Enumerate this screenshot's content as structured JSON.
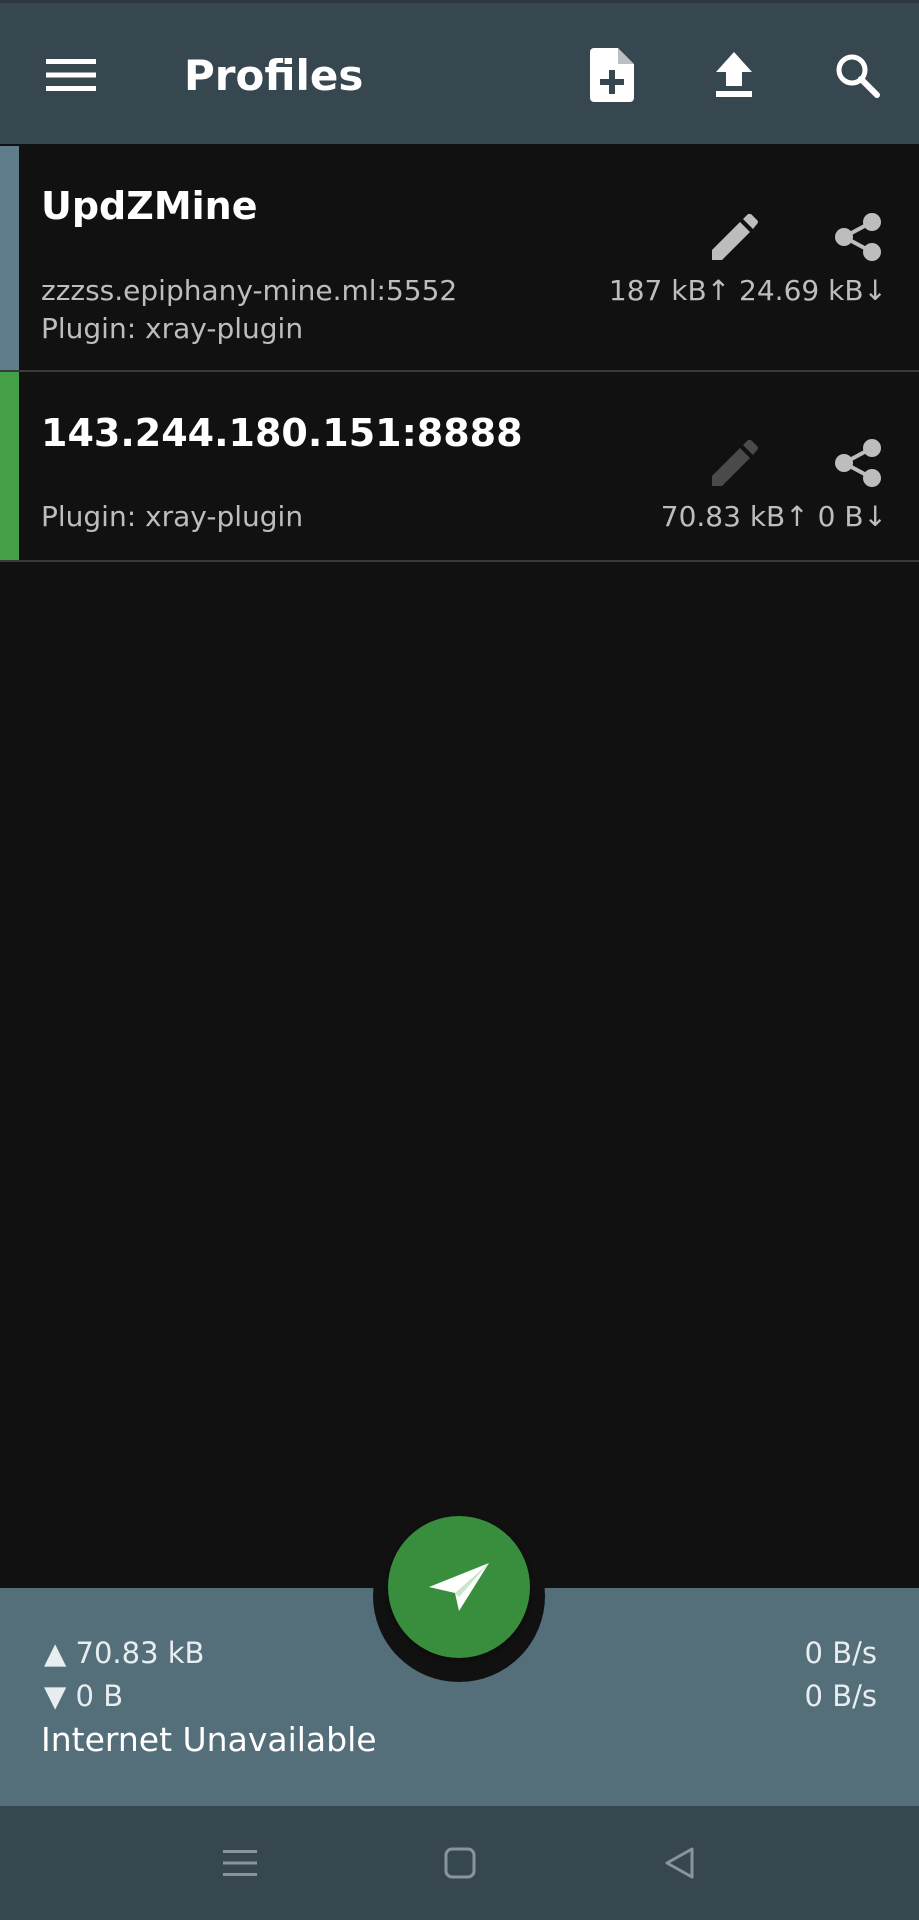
{
  "app_bar": {
    "title": "Profiles",
    "icons": [
      "menu-icon",
      "add-file-icon",
      "upload-icon",
      "search-icon"
    ]
  },
  "profiles": [
    {
      "name": "UpdZMine",
      "server": "zzzss.epiphany-mine.ml:5552",
      "plugin": "Plugin: xray-plugin",
      "traffic": "187 kB↑ 24.69 kB↓",
      "selected": false
    },
    {
      "name": "143.244.180.151:8888",
      "server": "",
      "plugin": "Plugin: xray-plugin",
      "traffic": "70.83 kB↑  0 B↓",
      "selected": true
    }
  ],
  "status": {
    "tx_total": "▲ 70.83 kB",
    "rx_total": "▼ 0 B",
    "tx_rate": "0 B/s",
    "rx_rate": "0 B/s",
    "connection": "Internet Unavailable"
  },
  "colors": {
    "app_bar": "#37474f",
    "status_bar": "#546e7a",
    "fab": "#388e3c",
    "selected_indicator": "#43a047",
    "unselected_indicator": "#607d8b"
  }
}
